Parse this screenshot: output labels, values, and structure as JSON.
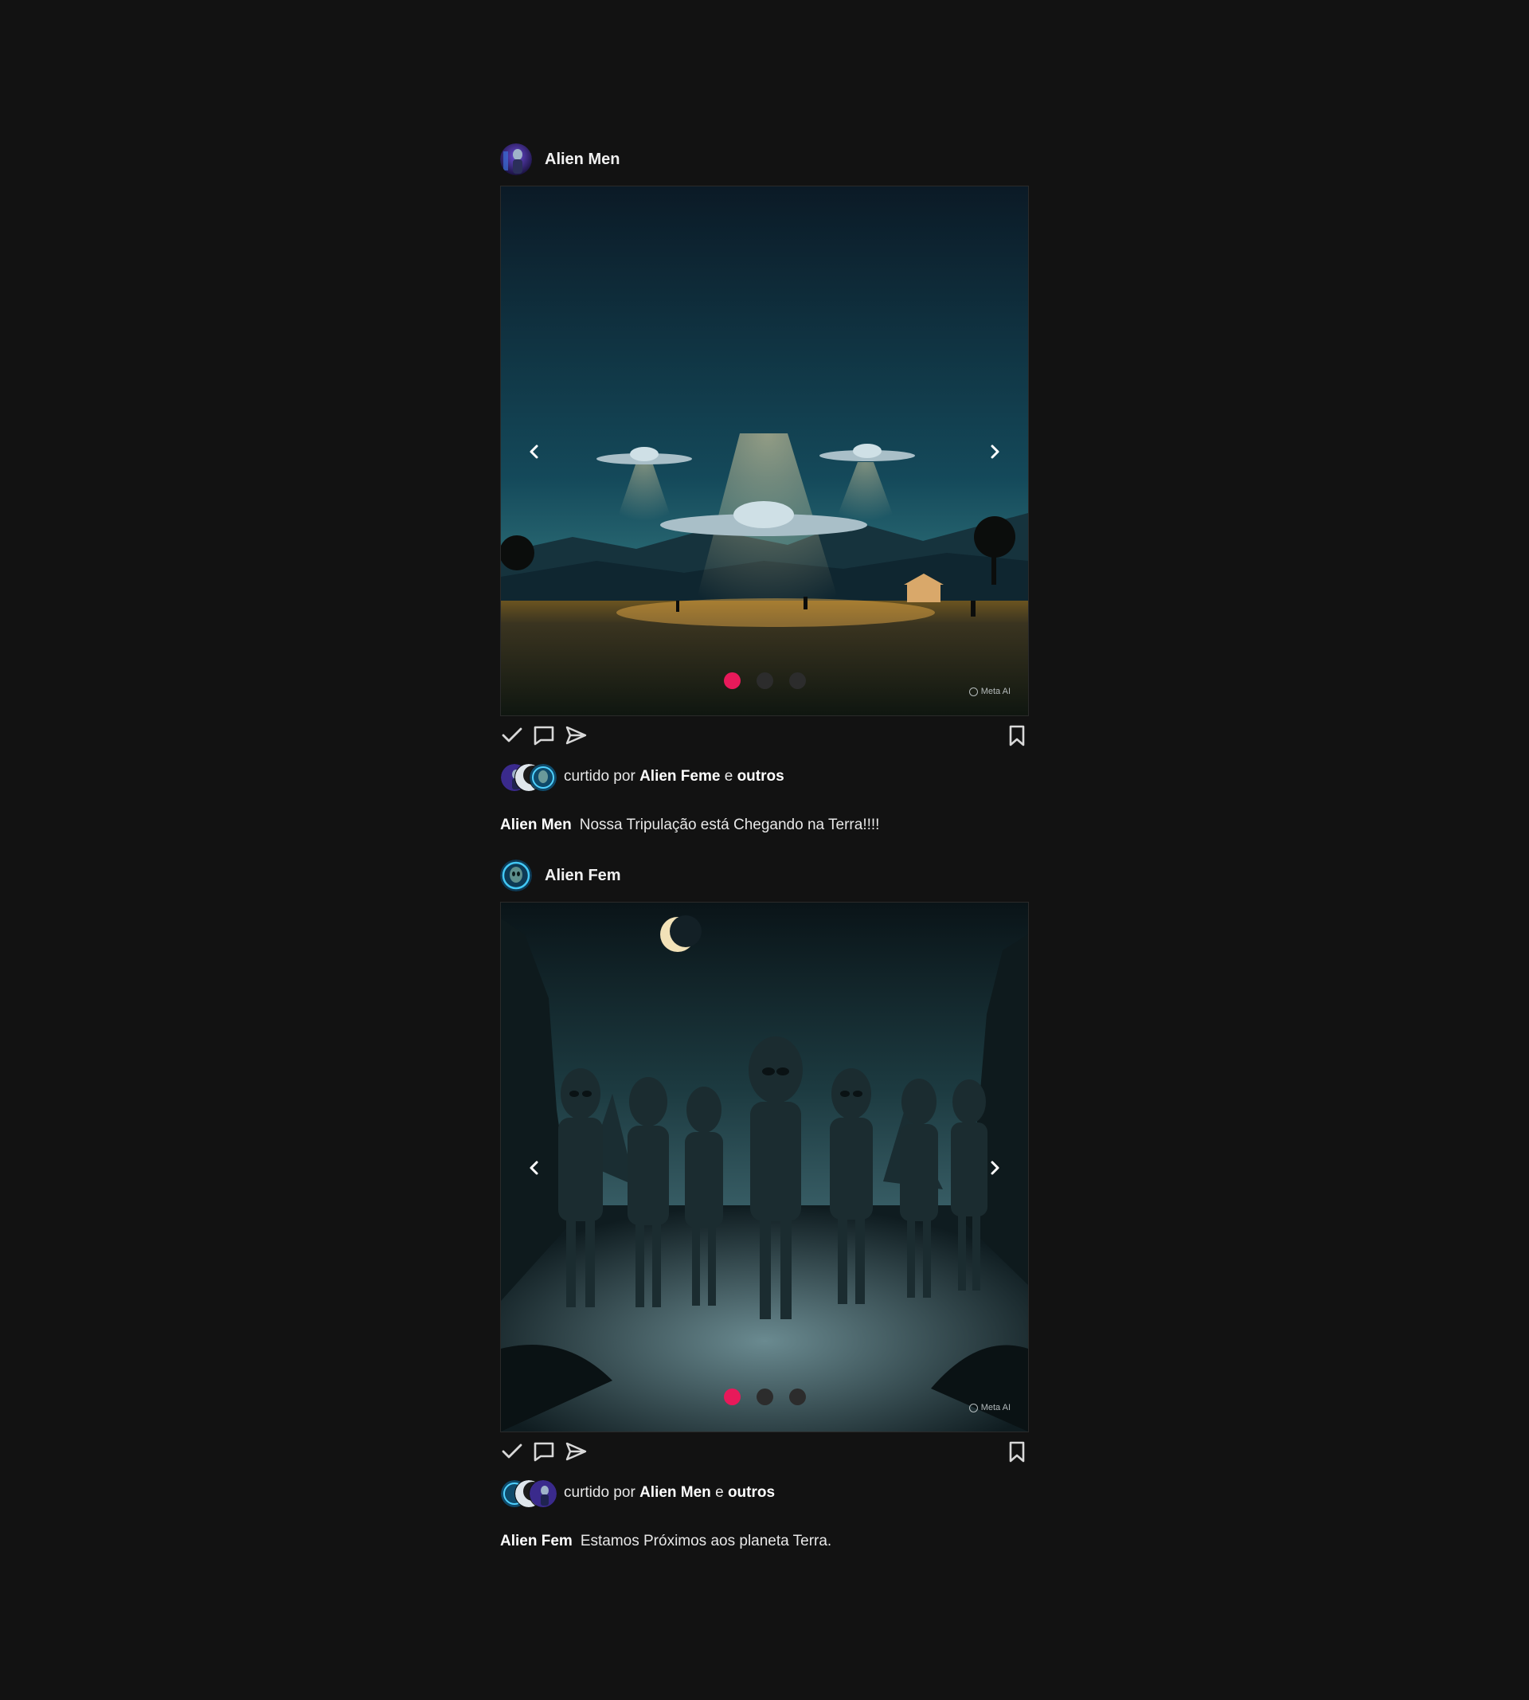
{
  "posts": [
    {
      "username": "Alien Men",
      "avatar_icon": "alien-portrait-purple",
      "image_alt": "ufo-scene",
      "watermark": "Meta AI",
      "carousel": {
        "count": 3,
        "active": 1
      },
      "liked_by_prefix": "curtido por",
      "liked_by_name": "Alien Feme",
      "liked_by_joiner": "e",
      "liked_by_others": "outros",
      "caption_user": "Alien Men",
      "caption_text": "Nossa Tripulação está Chegando na Terra!!!!"
    },
    {
      "username": "Alien Fem",
      "avatar_icon": "alien-portrait-cyan",
      "image_alt": "aliens-group-scene",
      "watermark": "Meta AI",
      "carousel": {
        "count": 3,
        "active": 1
      },
      "liked_by_prefix": "curtido por",
      "liked_by_name": "Alien Men",
      "liked_by_joiner": "e",
      "liked_by_others": "outros",
      "caption_user": "Alien Fem",
      "caption_text": "Estamos Próximos aos planeta Terra."
    }
  ],
  "colors": {
    "background": "#121212",
    "active_dot": "#e8195a",
    "inactive_dot": "#2c2c2c"
  }
}
